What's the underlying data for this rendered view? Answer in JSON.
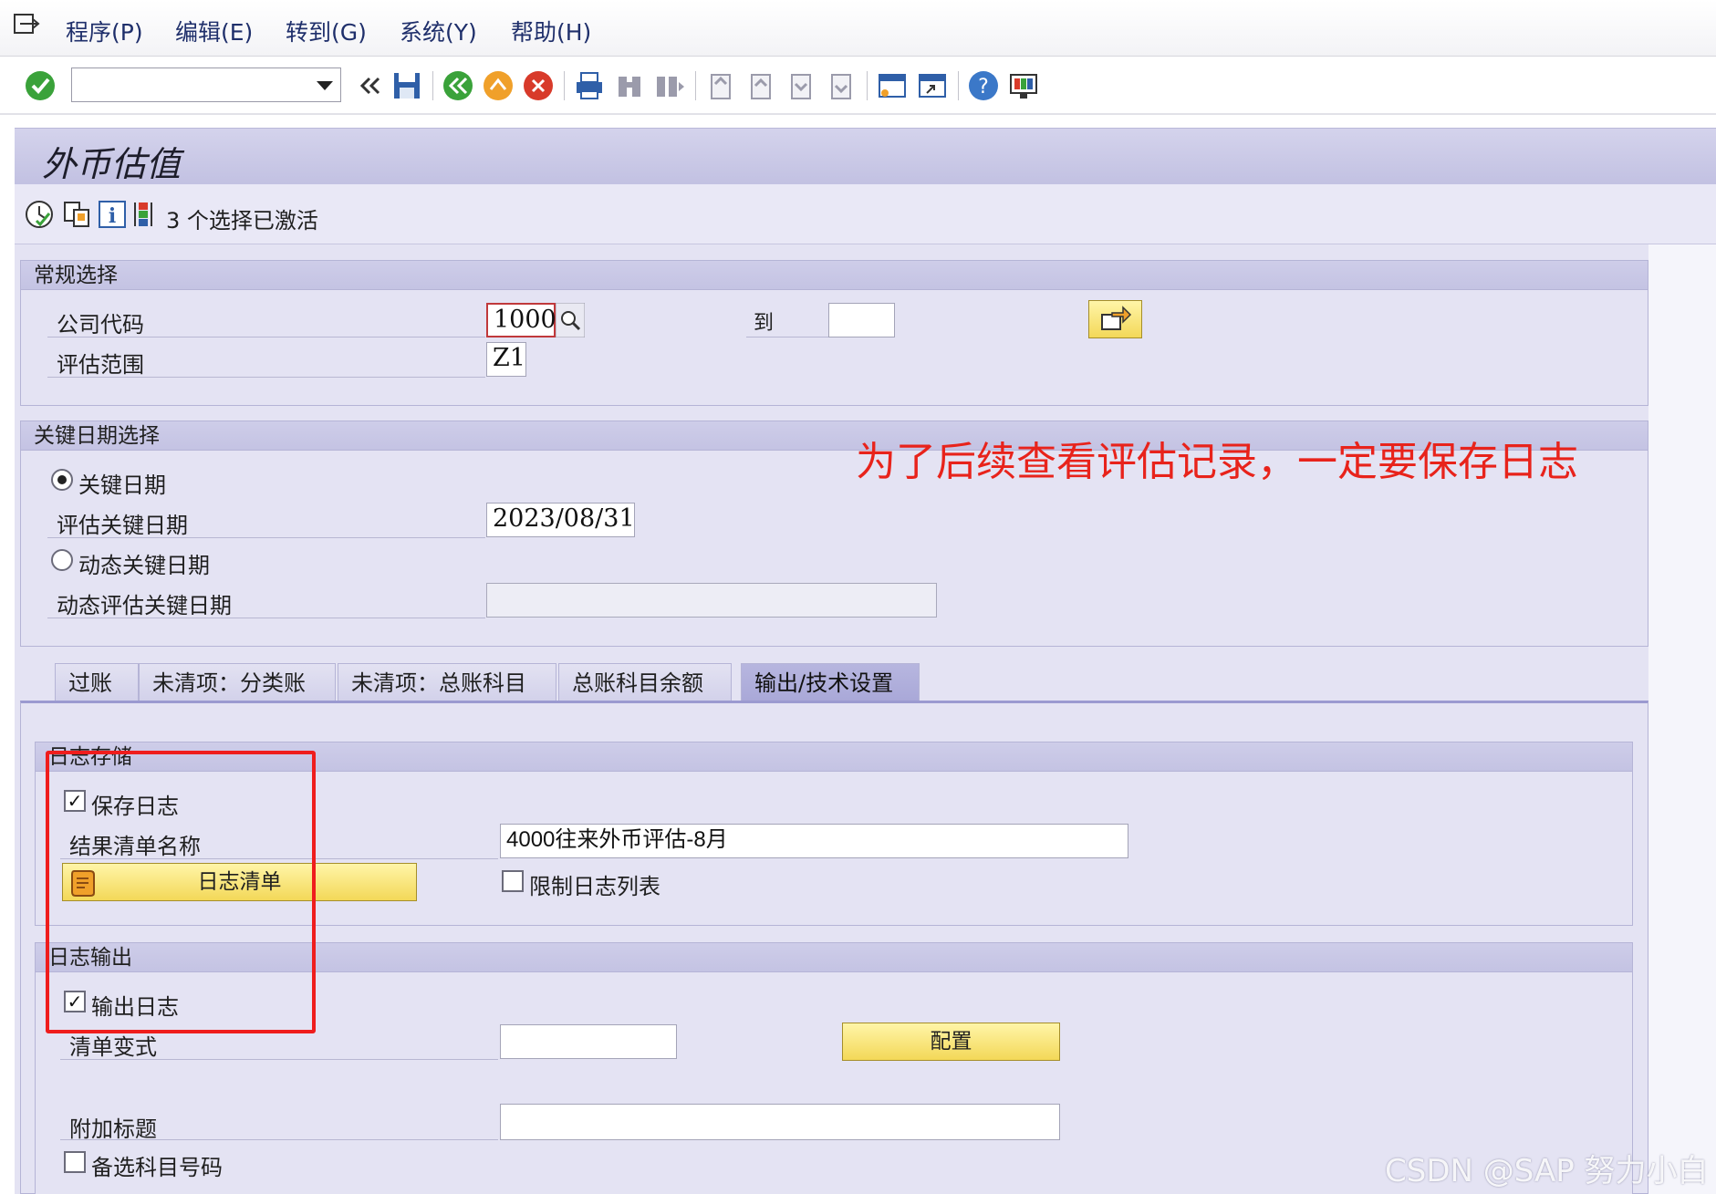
{
  "menu": {
    "items": [
      "程序(P)",
      "编辑(E)",
      "转到(G)",
      "系统(Y)",
      "帮助(H)"
    ]
  },
  "toolbar": {
    "command_value": "",
    "icons": [
      "enter-icon",
      "back-icon",
      "save-icon",
      "back-green-icon",
      "exit-icon",
      "cancel-icon",
      "print-icon",
      "find-icon",
      "find-next-icon",
      "first-page-icon",
      "prev-page-icon",
      "next-page-icon",
      "last-page-icon",
      "new-session-icon",
      "shortcut-icon",
      "help-icon",
      "layout-icon"
    ]
  },
  "title": "外币估值",
  "appbar": {
    "selections_text": "3 个选择已激活"
  },
  "general_selection": {
    "header": "常规选择",
    "company_code_label": "公司代码",
    "company_code_value": "1000",
    "to_label": "到",
    "to_value": "",
    "valuation_area_label": "评估范围",
    "valuation_area_value": "Z1"
  },
  "key_date_selection": {
    "header": "关键日期选择",
    "radio_key_date": "关键日期",
    "valuation_key_date_label": "评估关键日期",
    "valuation_key_date_value": "2023/08/31",
    "radio_dynamic_key_date": "动态关键日期",
    "dynamic_key_date_label": "动态评估关键日期",
    "dynamic_key_date_value": ""
  },
  "annotation": "为了后续查看评估记录，一定要保存日志",
  "tabs": [
    "过账",
    "未清项：分类账",
    "未清项：总账科目",
    "总账科目余额",
    "输出/技术设置"
  ],
  "log_storage": {
    "header": "日志存储",
    "save_log_label": "保存日志",
    "save_log_checked": true,
    "result_list_name_label": "结果清单名称",
    "result_list_name_value": "4000往来外币评估-8月",
    "log_list_button": "日志清单",
    "restrict_log_list_label": "限制日志列表",
    "restrict_log_list_checked": false
  },
  "log_output": {
    "header": "日志输出",
    "output_log_label": "输出日志",
    "output_log_checked": true,
    "list_variant_label": "清单变式",
    "list_variant_value": "",
    "config_button": "配置",
    "additional_title_label": "附加标题",
    "additional_title_value": "",
    "alt_account_label": "备选科目号码",
    "alt_account_checked": false
  },
  "watermark": "CSDN @SAP 努力小白",
  "colors": {
    "annotation_red": "#e8231b",
    "panel_bg": "#e4e3f3",
    "header_bg": "#c4c3e3",
    "button_yellow": "#f3d858"
  }
}
